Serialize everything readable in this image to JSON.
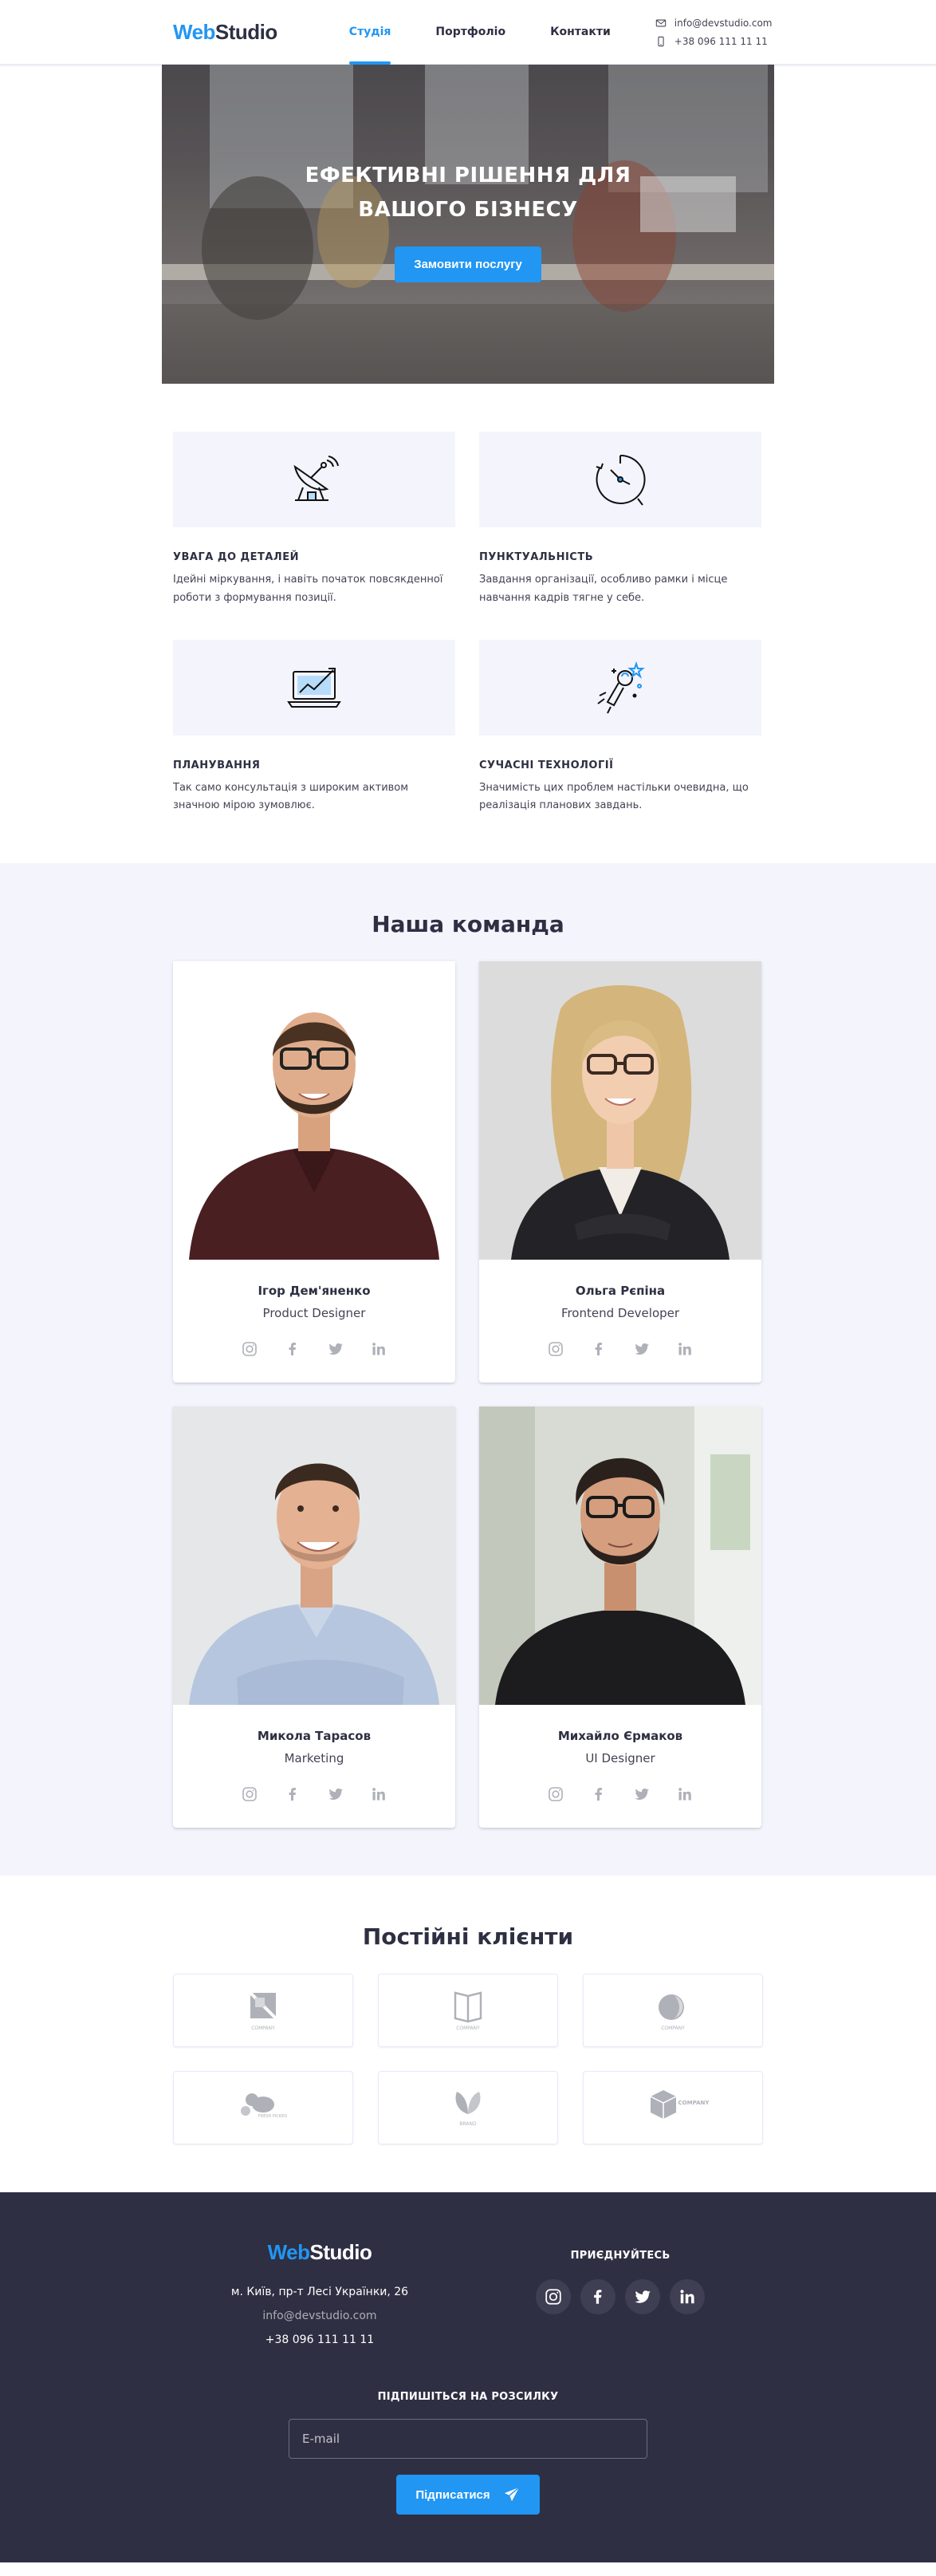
{
  "header": {
    "logo_primary": "Web",
    "logo_secondary": "Studio",
    "nav": [
      {
        "label": "Студія",
        "active": true
      },
      {
        "label": "Портфоліо",
        "active": false
      },
      {
        "label": "Контакти",
        "active": false
      }
    ],
    "email": "info@devstudio.com",
    "phone": "+38 096 111 11 11"
  },
  "hero": {
    "title": "Ефективні рішення для\nвашого бізнесу",
    "button": "Замовити послугу"
  },
  "features": [
    {
      "icon": "satellite-antenna-icon",
      "title": "Увага до деталей",
      "text": "Ідейні міркування, і навіть початок повсякденної роботи з формування позиції."
    },
    {
      "icon": "clock-icon",
      "title": "Пунктуальність",
      "text": "Завдання організації, особливо рамки і місце навчання кадрів тягне у себе."
    },
    {
      "icon": "laptop-chart-icon",
      "title": "Планування",
      "text": "Так само консультація з широким активом значною мірою зумовлює."
    },
    {
      "icon": "astronaut-rocket-icon",
      "title": "Сучасні технології",
      "text": "Значимість цих проблем настільки очевидна, що реалізація планових завдань."
    }
  ],
  "team": {
    "title": "Наша команда",
    "members": [
      {
        "name": "Ігор Дем'яненко",
        "role": "Product Designer"
      },
      {
        "name": "Ольга Рєпіна",
        "role": "Frontend Developer"
      },
      {
        "name": "Микола Тарасов",
        "role": "Marketing"
      },
      {
        "name": "Михайло Єрмаков",
        "role": "UI Designer"
      }
    ]
  },
  "clients": {
    "title": "Постійні клієнти",
    "logos": [
      {
        "icon": "client-logo-square-icon",
        "text": "COMPANY"
      },
      {
        "icon": "client-logo-book-icon",
        "text": "COMPANY"
      },
      {
        "icon": "client-logo-leaf-icon",
        "text": "COMPANY"
      },
      {
        "icon": "client-logo-blob-icon",
        "text": "FRESH PICKED"
      },
      {
        "icon": "client-logo-plant-icon",
        "text": "BRAND"
      },
      {
        "icon": "client-logo-cube-icon",
        "text": "COMPANY"
      }
    ]
  },
  "footer": {
    "logo_primary": "Web",
    "logo_secondary": "Studio",
    "address": "м. Київ, пр-т Лесі Українки, 26",
    "email": "info@devstudio.com",
    "phone": "+38 096 111 11 11",
    "join_title": "Приєднуйтесь",
    "subscribe_title": "Підпишіться на розсилку",
    "email_placeholder": "E-mail",
    "subscribe_button": "Підписатися"
  },
  "colors": {
    "accent": "#2196f3",
    "dark": "#2e2f42",
    "light_bg": "#f4f4fd"
  }
}
